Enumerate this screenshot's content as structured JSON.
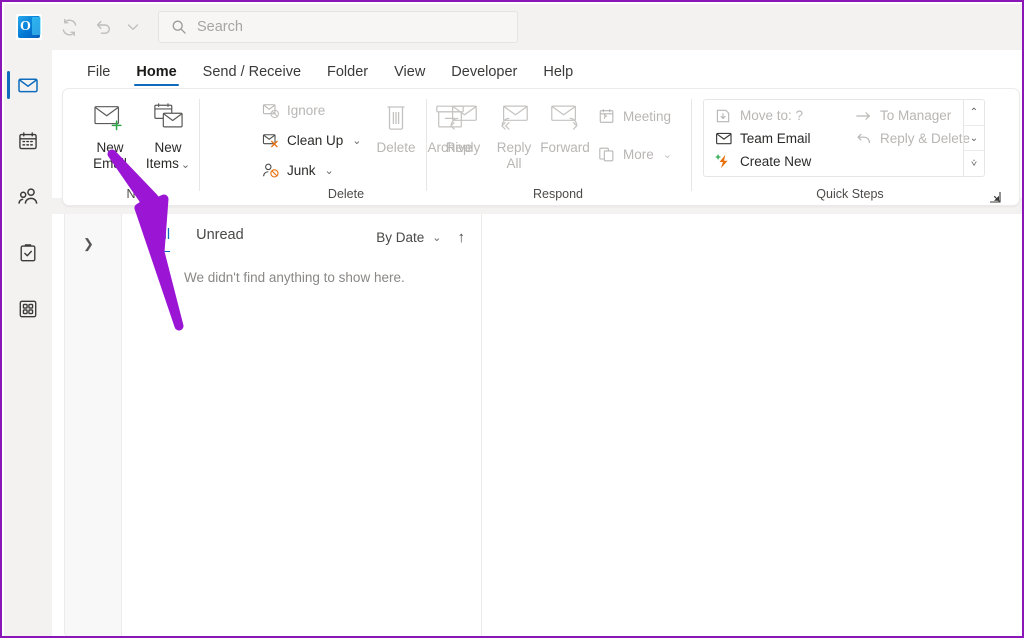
{
  "window": {
    "titlebar": {
      "logo_icon": "outlook-logo",
      "buttons": [
        {
          "icon": "sync-icon",
          "name": "send-receive-all-button"
        },
        {
          "icon": "undo-icon",
          "name": "undo-button"
        },
        {
          "icon": "chevron-down-icon",
          "name": "customize-quick-access-toolbar-button"
        }
      ],
      "search": {
        "placeholder": "Search",
        "value": "",
        "icon": "search-icon"
      }
    },
    "rail": [
      {
        "label": "Mail",
        "icon": "mail-icon",
        "selected": true
      },
      {
        "label": "Calendar",
        "icon": "calendar-icon",
        "selected": false
      },
      {
        "label": "People",
        "icon": "people-icon",
        "selected": false
      },
      {
        "label": "To Do",
        "icon": "tasks-clipboard-icon",
        "selected": false
      },
      {
        "label": "More apps",
        "icon": "apps-grid-icon",
        "selected": false
      }
    ],
    "tabs": [
      {
        "label": "File",
        "active": false
      },
      {
        "label": "Home",
        "active": true
      },
      {
        "label": "Send / Receive",
        "active": false
      },
      {
        "label": "Folder",
        "active": false
      },
      {
        "label": "View",
        "active": false
      },
      {
        "label": "Developer",
        "active": false
      },
      {
        "label": "Help",
        "active": false
      }
    ],
    "ribbon": {
      "groups": [
        {
          "name": "new",
          "label": "New",
          "big_buttons": [
            {
              "label_line1": "New",
              "label_line2": "Email",
              "icon": "new-email-icon",
              "disabled": false,
              "caret": false
            },
            {
              "label_line1": "New",
              "label_line2": "Items",
              "icon": "new-items-icon",
              "disabled": false,
              "caret": true
            }
          ]
        },
        {
          "name": "delete",
          "label": "Delete",
          "small_buttons": [
            {
              "label": "Ignore",
              "icon": "ignore-icon",
              "disabled": true,
              "caret": false
            },
            {
              "label": "Clean Up",
              "icon": "clean-up-icon",
              "disabled": false,
              "caret": true
            },
            {
              "label": "Junk",
              "icon": "junk-icon",
              "disabled": false,
              "caret": true
            }
          ],
          "big_buttons": [
            {
              "label_line1": "Delete",
              "label_line2": "",
              "icon": "trash-icon",
              "disabled": true,
              "caret": false
            },
            {
              "label_line1": "Archive",
              "label_line2": "",
              "icon": "archive-icon",
              "disabled": true,
              "caret": false
            }
          ]
        },
        {
          "name": "respond",
          "label": "Respond",
          "big_buttons": [
            {
              "label_line1": "Reply",
              "label_line2": "",
              "icon": "reply-icon",
              "disabled": true,
              "caret": false
            },
            {
              "label_line1": "Reply",
              "label_line2": "All",
              "icon": "reply-all-icon",
              "disabled": true,
              "caret": false
            },
            {
              "label_line1": "Forward",
              "label_line2": "",
              "icon": "forward-icon",
              "disabled": true,
              "caret": false
            }
          ],
          "small_buttons": [
            {
              "label": "Meeting",
              "icon": "meeting-icon",
              "disabled": true,
              "caret": false
            },
            {
              "label": "More",
              "icon": "more-respond-icon",
              "disabled": true,
              "caret": true
            }
          ]
        },
        {
          "name": "quick-steps",
          "label": "Quick Steps",
          "gallery": [
            {
              "label": "Move to: ?",
              "icon": "move-to-icon",
              "disabled": true
            },
            {
              "label": "To Manager",
              "icon": "to-manager-icon",
              "disabled": true
            },
            {
              "label": "Team Email",
              "icon": "team-email-icon",
              "disabled": false
            },
            {
              "label": "Reply & Delete",
              "icon": "reply-and-delete-icon",
              "disabled": true
            },
            {
              "label": "Create New",
              "icon": "create-new-quick-step-icon",
              "disabled": false
            }
          ],
          "scroll": [
            {
              "icon": "scroll-up-icon"
            },
            {
              "icon": "scroll-down-icon"
            },
            {
              "icon": "gallery-expand-icon"
            }
          ],
          "dialog_launcher": "dialog-box-launcher-icon"
        }
      ]
    },
    "content": {
      "folder_pane": {
        "expand_icon": "chevron-right-icon",
        "collapsed": true
      },
      "message_list": {
        "filters": [
          {
            "label": "All",
            "active": true
          },
          {
            "label": "Unread",
            "active": false
          }
        ],
        "sort": {
          "label": "By Date",
          "caret_icon": "chevron-down-icon",
          "direction_icon": "arrow-up-icon"
        },
        "empty_state": "We didn't find anything to show here."
      }
    },
    "annotation": {
      "type": "arrow",
      "color": "#9b16d4",
      "points_to": "New Email",
      "frame_color": "#8b16b8"
    }
  }
}
